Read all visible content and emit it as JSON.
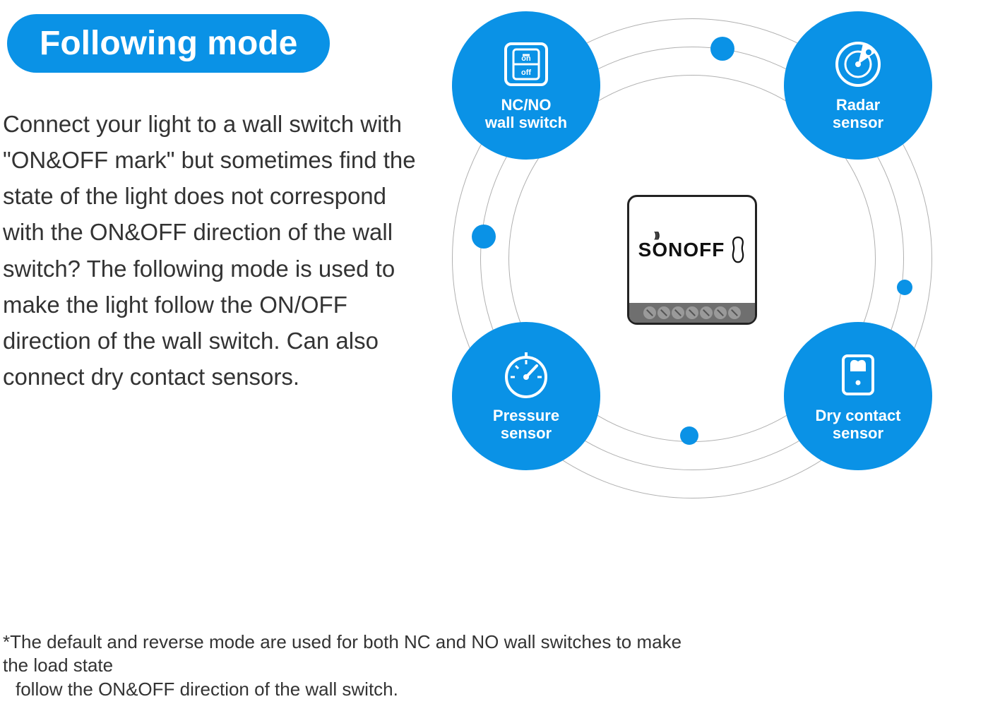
{
  "title": "Following mode",
  "body": "Connect your light to a wall switch with \"ON&OFF mark\" but sometimes find the state of the light does not correspond with the ON&OFF direction of the wall switch? The following mode is used to make the light follow the ON/OFF direction of the wall switch. Can also connect dry contact sensors.",
  "footnote_line1": "*The default and reverse mode are used for both NC and NO wall switches to make the load state",
  "footnote_line2": "follow the ON&OFF direction of the wall switch.",
  "center_device": {
    "brand": "SONOFF"
  },
  "bubbles": {
    "top_left": {
      "label_line1": "NC/NO",
      "label_line2": "wall switch",
      "icon": "wall-switch"
    },
    "top_right": {
      "label_line1": "Radar",
      "label_line2": "sensor",
      "icon": "radar"
    },
    "bottom_left": {
      "label_line1": "Pressure",
      "label_line2": "sensor",
      "icon": "gauge"
    },
    "bottom_right": {
      "label_line1": "Dry contact",
      "label_line2": "sensor",
      "icon": "contact"
    }
  },
  "switch_icon": {
    "top": "on",
    "bottom": "off"
  },
  "colors": {
    "accent": "#0a92e6"
  }
}
